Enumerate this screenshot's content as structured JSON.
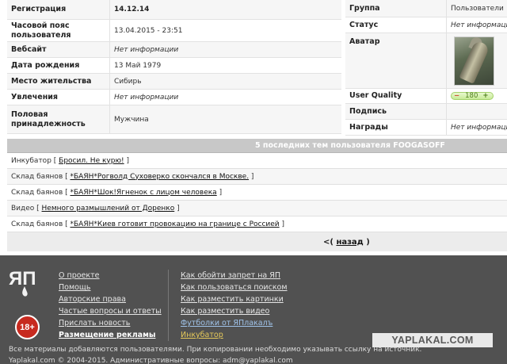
{
  "profile_left": [
    {
      "label": "Регистрация",
      "value": "14.12.14",
      "bold": true,
      "italic": false
    },
    {
      "label": "Часовой пояс пользователя",
      "value": "13.04.2015 - 23:51",
      "bold": false,
      "italic": false
    },
    {
      "label": "Вебсайт",
      "value": "Нет информации",
      "bold": false,
      "italic": true
    },
    {
      "label": "Дата рождения",
      "value": "13 Май 1979",
      "bold": false,
      "italic": false
    },
    {
      "label": "Место жительства",
      "value": "Сибирь",
      "bold": false,
      "italic": false
    },
    {
      "label": "Увлечения",
      "value": "Нет информации",
      "bold": false,
      "italic": true
    },
    {
      "label": "Половая принадлежность",
      "value": "Мужчина",
      "bold": false,
      "italic": false
    }
  ],
  "profile_right": {
    "group": {
      "label": "Группа",
      "value": "Пользователи"
    },
    "status": {
      "label": "Статус",
      "value": "Нет информации"
    },
    "avatar": {
      "label": "Аватар"
    },
    "quality": {
      "label": "User Quality",
      "minus": "−",
      "value": "180",
      "plus": "+"
    },
    "signature": {
      "label": "Подпись",
      "value": ""
    },
    "awards": {
      "label": "Награды",
      "value": "Нет информации"
    }
  },
  "topics": {
    "header": "5 последних тем пользователя FOOGASOFF",
    "items": [
      {
        "section": "Инкубатор",
        "title": "Бросил. Не курю!"
      },
      {
        "section": "Склад баянов",
        "title": "*БАЯН*Рогволд Суховерко скончался в Москве."
      },
      {
        "section": "Склад баянов",
        "title": "*БАЯН*Шок!Ягненок с лицом человека"
      },
      {
        "section": "Видео",
        "title": "Немного размышлений от Доренко"
      },
      {
        "section": "Склад баянов",
        "title": "*БАЯН*Киев готовит провокацию на границе с Россией"
      }
    ],
    "back_prefix": "<(",
    "back_label": "назад",
    "back_suffix": ")"
  },
  "footer": {
    "logo_text": "ЯП",
    "age_badge": "18+",
    "col1": [
      "О проекте",
      "Помощь",
      "Авторские права",
      "Частые вопросы и ответы",
      "Прислать новость",
      "Размещение рекламы"
    ],
    "col2": [
      "Как обойти запрет на ЯП",
      "Как пользоваться поиском",
      "Как разместить картинки",
      "Как разместить видео",
      "Футболки от ЯПлакалъ",
      "Инкубатор"
    ],
    "brand": "YAPLAKAL.COM",
    "notice": "Все материалы добавляются пользователями. При копировании необходимо указывать ссылку на источник.",
    "copyright": "Yaplakal.com © 2004-2015. Административные вопросы: adm@yaplakal.com"
  },
  "colors": {
    "footer_bg": "#515151",
    "topics_header_bg": "#c8c8c8",
    "age_badge_red": "#c72a1f",
    "footer_link_yellow": "#e5c95a",
    "footer_link_blue": "#9fc2e8"
  }
}
